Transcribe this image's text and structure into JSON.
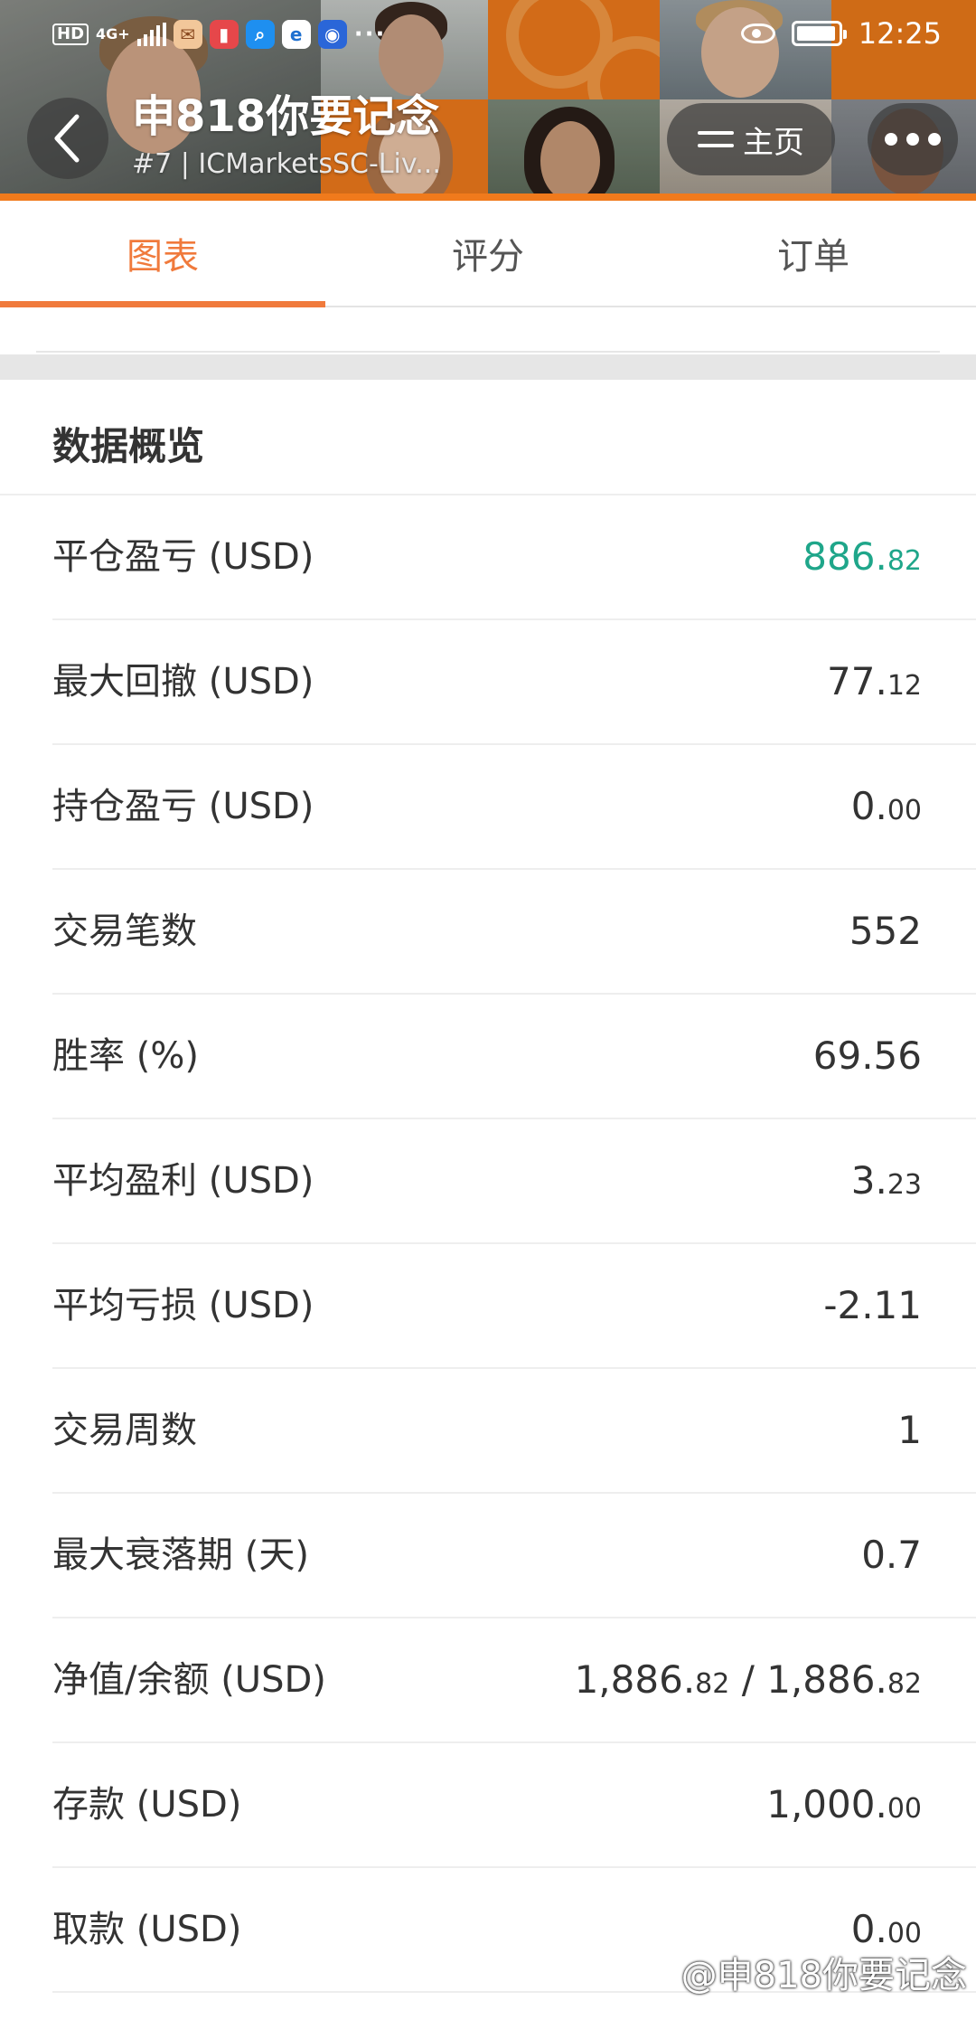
{
  "status_bar": {
    "hd": "HD",
    "network": "4G+",
    "time": "12:25",
    "app_icons": [
      "app-icon-1",
      "app-icon-2",
      "search-app-icon",
      "browser-app-icon",
      "bulb-app-icon"
    ]
  },
  "header": {
    "title": "申818你要记念",
    "subtitle": "#7 | ICMarketsSC-Liv...",
    "home_label": "主页"
  },
  "tabs": [
    {
      "label": "图表",
      "active": true
    },
    {
      "label": "评分",
      "active": false
    },
    {
      "label": "订单",
      "active": false
    }
  ],
  "section": {
    "title": "数据概览",
    "rows": [
      {
        "label": "平仓盈亏 (USD)",
        "main": "886.",
        "small": "82",
        "color": "#1fa68a"
      },
      {
        "label": "最大回撤 (USD)",
        "main": "77.",
        "small": "12"
      },
      {
        "label": "持仓盈亏 (USD)",
        "main": "0.",
        "small": "00"
      },
      {
        "label": "交易笔数",
        "main": "552",
        "small": ""
      },
      {
        "label": "胜率 (%)",
        "main": "69.56",
        "small": ""
      },
      {
        "label": "平均盈利 (USD)",
        "main": "3.",
        "small": "23"
      },
      {
        "label": "平均亏损 (USD)",
        "main": "-2.11",
        "small": ""
      },
      {
        "label": "交易周数",
        "main": "1",
        "small": ""
      },
      {
        "label": "最大衰落期 (天)",
        "main": "0.7",
        "small": ""
      },
      {
        "label": "净值/余额 (USD)",
        "main": "1,886.",
        "small": "82",
        "main2": " / 1,886.",
        "small2": "82"
      },
      {
        "label": "存款 (USD)",
        "main": "1,000.",
        "small": "00"
      },
      {
        "label": "取款 (USD)",
        "main": "0.",
        "small": "00"
      }
    ]
  },
  "watermark": "@申818你要记念"
}
